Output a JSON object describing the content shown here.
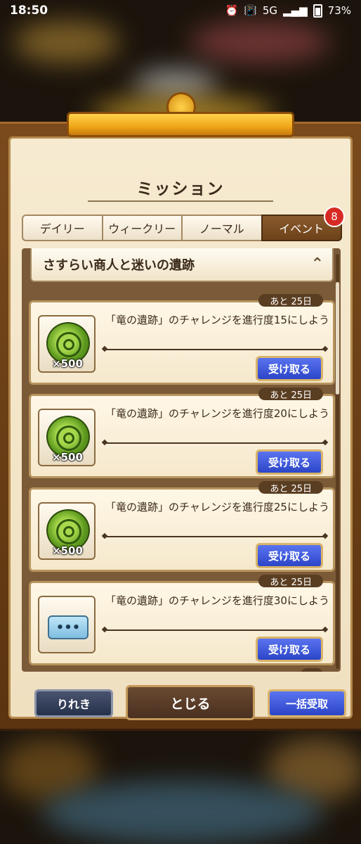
{
  "statusbar": {
    "time": "18:50",
    "network": "5G",
    "battery": "73%"
  },
  "dialog": {
    "title": "ミッション"
  },
  "tabs": [
    {
      "label": "デイリー"
    },
    {
      "label": "ウィークリー"
    },
    {
      "label": "ノーマル"
    },
    {
      "label": "イベント",
      "badge": "8",
      "active": true
    }
  ],
  "section": {
    "title": "さすらい商人と迷いの遺跡"
  },
  "missions": [
    {
      "remain": "あと 25日",
      "text": "「竜の遺跡」のチャレンジを進行度15にしよう",
      "reward": "medal",
      "qty": "×500",
      "button": "受け取る"
    },
    {
      "remain": "あと 25日",
      "text": "「竜の遺跡」のチャレンジを進行度20にしよう",
      "reward": "medal",
      "qty": "×500",
      "button": "受け取る"
    },
    {
      "remain": "あと 25日",
      "text": "「竜の遺跡」のチャレンジを進行度25にしよう",
      "reward": "medal",
      "qty": "×500",
      "button": "受け取る"
    },
    {
      "remain": "あと 25日",
      "text": "「竜の遺跡」のチャレンジを進行度30にしよう",
      "reward": "ticket",
      "qty": "",
      "button": "受け取る"
    }
  ],
  "footer": {
    "history": "りれき",
    "close": "とじる",
    "claim_all": "一括受取"
  },
  "icons": {
    "ticket_glyph": "•••",
    "collapse": "chevron-up-double-icon"
  },
  "colors": {
    "accent_blue": "#2c45c8",
    "badge_red": "#d72a24",
    "frame_brown": "#7a4a1c"
  }
}
